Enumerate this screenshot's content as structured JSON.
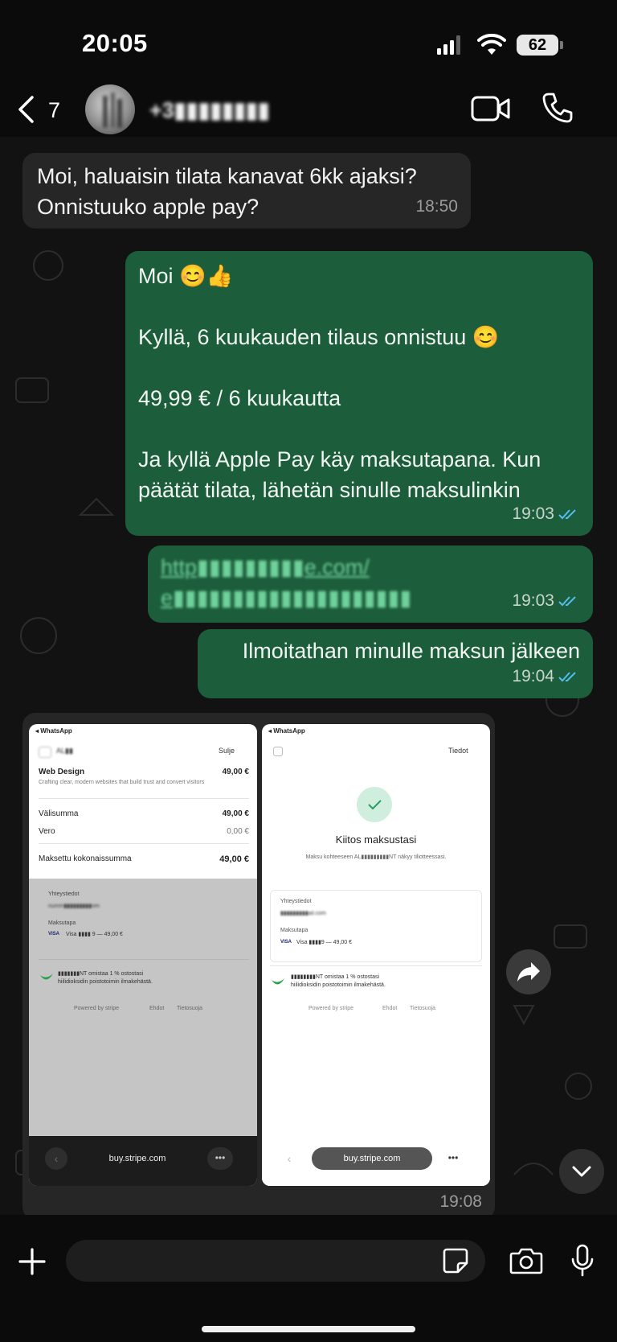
{
  "status_bar": {
    "time": "20:05",
    "battery": "62"
  },
  "header": {
    "back_count": "7",
    "contact_name": "+3▮▮▮▮▮▮▮▮"
  },
  "messages": [
    {
      "direction": "incoming",
      "text_lines": [
        "Moi, haluaisin tilata kanavat 6kk ajaksi?",
        "Onnistuuko apple pay?"
      ],
      "time": "18:50"
    },
    {
      "direction": "outgoing",
      "text_lines": [
        "Moi 😊👍",
        "",
        "Kyllä, 6 kuukauden tilaus onnistuu 😊",
        "",
        "49,99 € / 6 kuukautta",
        "",
        "Ja kyllä Apple Pay käy maksutapana. Kun",
        "päätät tilata, lähetän sinulle maksulinkin"
      ],
      "time": "19:03",
      "read": true
    },
    {
      "direction": "outgoing",
      "link_lines": [
        "http▮▮▮▮▮▮▮▮▮e.com/",
        "e▮▮▮▮▮▮▮▮▮▮▮▮▮▮▮▮▮▮▮▮"
      ],
      "time": "19:03",
      "read": true
    },
    {
      "direction": "outgoing",
      "text_lines": [
        "Ilmoitathan minulle maksun jälkeen"
      ],
      "time": "19:04",
      "read": true
    }
  ],
  "image_message": {
    "time": "19:08",
    "left_screenshot": {
      "status": "◂ WhatsApp",
      "merchant": "AL▮▮",
      "close_label": "Sulje",
      "item_name": "Web Design",
      "item_price": "49,00 €",
      "item_desc": "Crafting clear, modern websites that build trust and convert visitors",
      "subtotal_label": "Välisumma",
      "subtotal": "49,00 €",
      "tax_label": "Vero",
      "tax": "0,00 €",
      "total_label": "Maksettu kokonaissumma",
      "total": "49,00 €",
      "contact_label": "Yhteystiedot",
      "contact_value": "numm▮▮▮▮▮▮▮▮▮om",
      "method_label": "Maksutapa",
      "card_brand": "VISA",
      "card_value": "Visa ▮▮▮▮ 9 — 49,00 €",
      "promo_text": "▮▮▮▮▮▮▮NT omistaa 1 % ostostasi",
      "promo_text2": "hiilidioksidin poistotoimin ilmakehästä.",
      "powered": "Powered by stripe",
      "terms": "Ehdot",
      "privacy": "Tietosuoja",
      "url": "buy.stripe.com"
    },
    "right_screenshot": {
      "status": "◂ WhatsApp",
      "details_label": "Tiedot",
      "thanks_title": "Kiitos maksustasi",
      "thanks_text": "Maksu kohteeseen AL▮▮▮▮▮▮▮▮▮NT näkyy tiliotteessasi.",
      "contact_label": "Yhteystiedot",
      "contact_value": "▮▮▮▮▮▮▮▮▮ail.com",
      "method_label": "Maksutapa",
      "card_brand": "VISA",
      "card_value": "Visa ▮▮▮▮9 — 49,00 €",
      "promo_text": "▮▮▮▮▮▮▮▮NT omistaa 1 % ostostasi",
      "promo_text2": "hiilidioksidin poistotoimin ilmakehästä.",
      "powered": "Powered by stripe",
      "terms": "Ehdot",
      "privacy": "Tietosuoja",
      "url": "buy.stripe.com"
    }
  },
  "composer": {
    "placeholder": ""
  },
  "colors": {
    "outgoing_bubble": "#1c5d3b",
    "incoming_bubble": "#262626",
    "read_ticks": "#53bdeb",
    "link": "#6fd19b"
  },
  "icons": [
    "back-chevron-icon",
    "video-call-icon",
    "phone-icon",
    "forward-icon",
    "chevron-down-icon",
    "plus-icon",
    "sticker-icon",
    "camera-icon",
    "microphone-icon"
  ]
}
